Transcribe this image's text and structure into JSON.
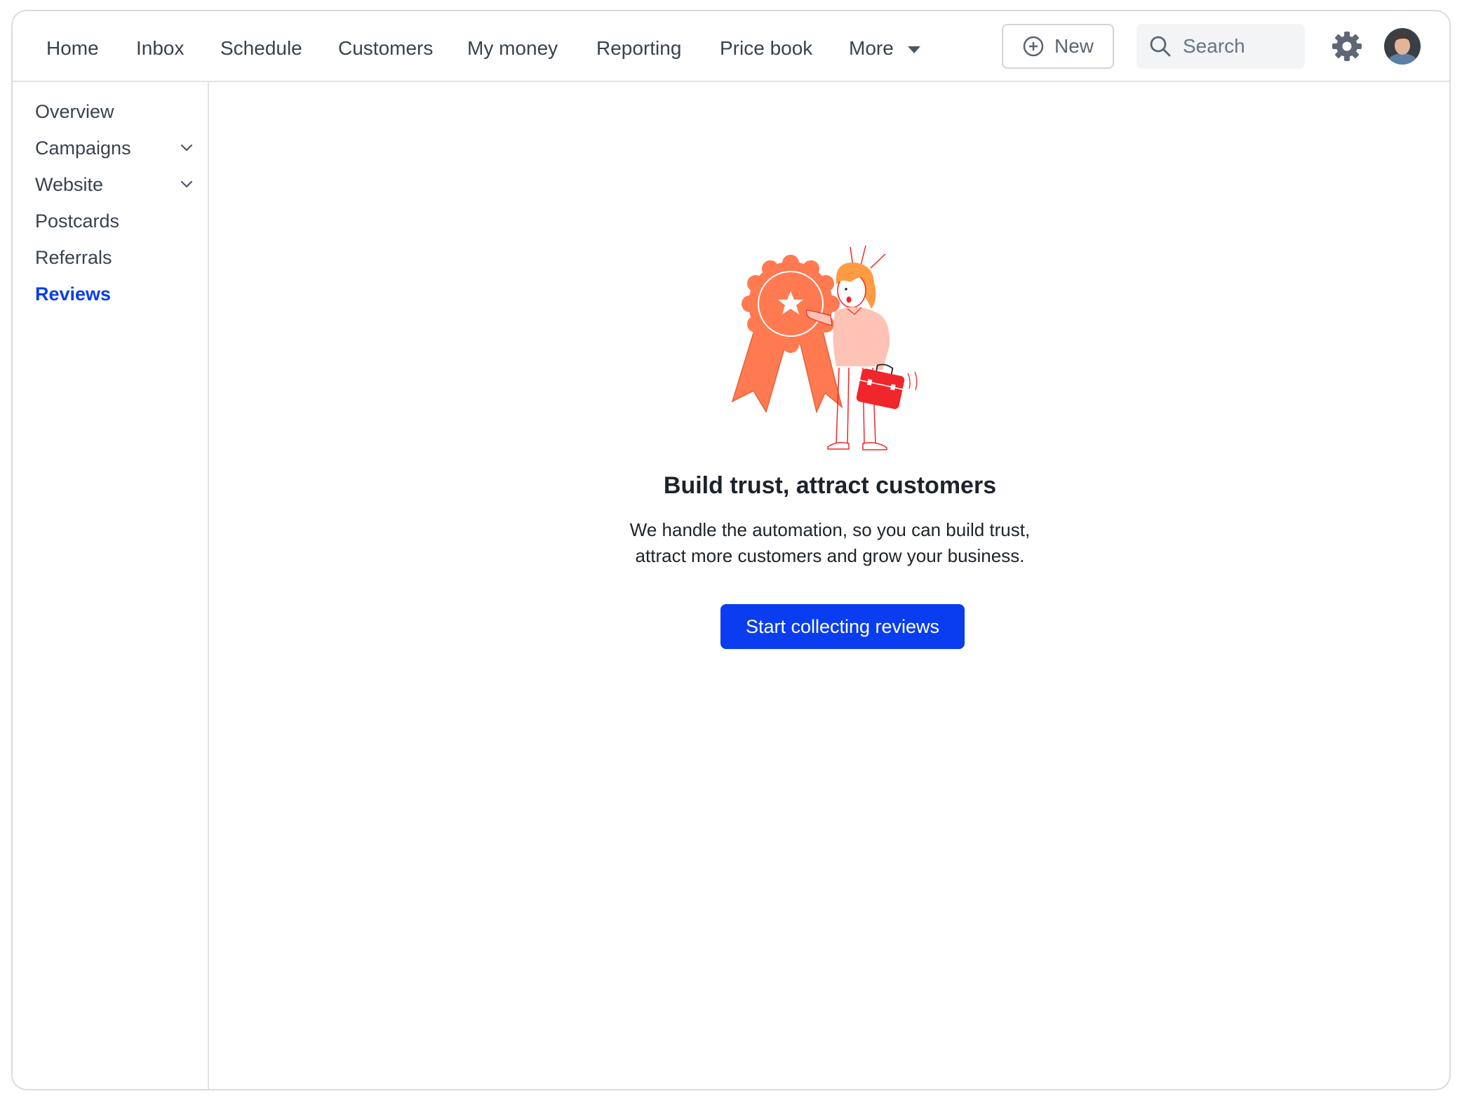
{
  "nav": {
    "items": [
      "Home",
      "Inbox",
      "Schedule",
      "Customers",
      "My money",
      "Reporting",
      "Price book"
    ],
    "more_label": "More",
    "new_label": "New",
    "search_placeholder": "Search"
  },
  "sidebar": {
    "items": [
      {
        "label": "Overview"
      },
      {
        "label": "Campaigns"
      },
      {
        "label": "Website"
      },
      {
        "label": "Postcards"
      },
      {
        "label": "Referrals"
      },
      {
        "label": "Reviews"
      }
    ]
  },
  "main": {
    "headline": "Build trust, attract customers",
    "subtext_line1": "We handle the automation, so you can build trust,",
    "subtext_line2": "attract more customers and grow your business.",
    "cta_label": "Start collecting reviews"
  },
  "colors": {
    "accent": "#0a3df0",
    "illustration_orange": "#ff7a50",
    "illustration_red": "#f0262a"
  },
  "icons": [
    "plus-circle-icon",
    "search-icon",
    "gear-icon",
    "chevron-down-icon",
    "caret-down-icon"
  ]
}
